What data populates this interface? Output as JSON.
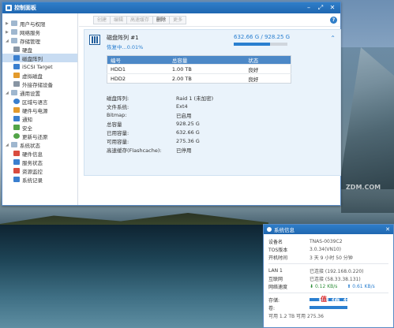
{
  "window": {
    "title": "控制面板",
    "btn_minimize": "–",
    "btn_maximize": "⤢",
    "btn_close": "✕"
  },
  "sidebar": {
    "groups": [
      {
        "label": "用户与权限"
      },
      {
        "label": "网络服务"
      },
      {
        "label": "存储管理"
      },
      {
        "label": "通用设置"
      },
      {
        "label": "系统状态"
      }
    ],
    "storage_items": [
      "硬盘",
      "磁盘阵列",
      "iSCSI Target",
      "虚拟磁盘",
      "外接存储设备"
    ],
    "general_items": [
      "区域与语言",
      "硬件与电源",
      "通知",
      "安全",
      "更新与还原"
    ],
    "status_items": [
      "硬件信息",
      "服务状态",
      "资源监控",
      "系统记录"
    ]
  },
  "toolbar": {
    "buttons": [
      "创建",
      "编辑",
      "高速缓存",
      "删除",
      "更多"
    ]
  },
  "raid": {
    "name": "磁盘阵列 #1",
    "status": "恢复中...0.01%",
    "capacity": "632.66 G / 928.25 G",
    "used_fraction": 0.68,
    "table": {
      "headers": [
        "编号",
        "总容量",
        "状态"
      ],
      "rows": [
        [
          "HDD1",
          "1.00 TB",
          "良好"
        ],
        [
          "HDD2",
          "2.00 TB",
          "良好"
        ]
      ]
    },
    "props": [
      {
        "k": "磁盘阵列:",
        "v": "Raid 1 (未加密)"
      },
      {
        "k": "文件系统:",
        "v": "Ext4"
      },
      {
        "k": "Bitmap:",
        "v": "已启用"
      },
      {
        "k": "总容量",
        "v": "928.25 G"
      },
      {
        "k": "已用容量:",
        "v": "632.66 G"
      },
      {
        "k": "可用容量:",
        "v": "275.36 G"
      },
      {
        "k": "高速缓存(Flashcache):",
        "v": "已停用"
      }
    ]
  },
  "sysinfo": {
    "title": "系统信息",
    "rows": [
      {
        "k": "设备名",
        "v": "TNAS-0039C2"
      },
      {
        "k": "TOS版本",
        "v": "3.0.34(VN10)"
      },
      {
        "k": "开机时间",
        "v": "3 天 9 小时 50 分钟"
      }
    ],
    "net": [
      {
        "k": "LAN 1",
        "v": "已连接 (192.168.0.220)"
      },
      {
        "k": "互联网",
        "v": "已连接 (58.33.38.131)"
      }
    ],
    "speed_label": "网络速度",
    "down": "0.12 KB/s",
    "up": "0.61 KB/s",
    "storage_label": "存储:",
    "volume_label": "卷:",
    "footer": "可用 1.2 TB 可用 275.36"
  },
  "watermark": {
    "brand": "值 什么值得买",
    "zdm": "ZDM.COM"
  }
}
